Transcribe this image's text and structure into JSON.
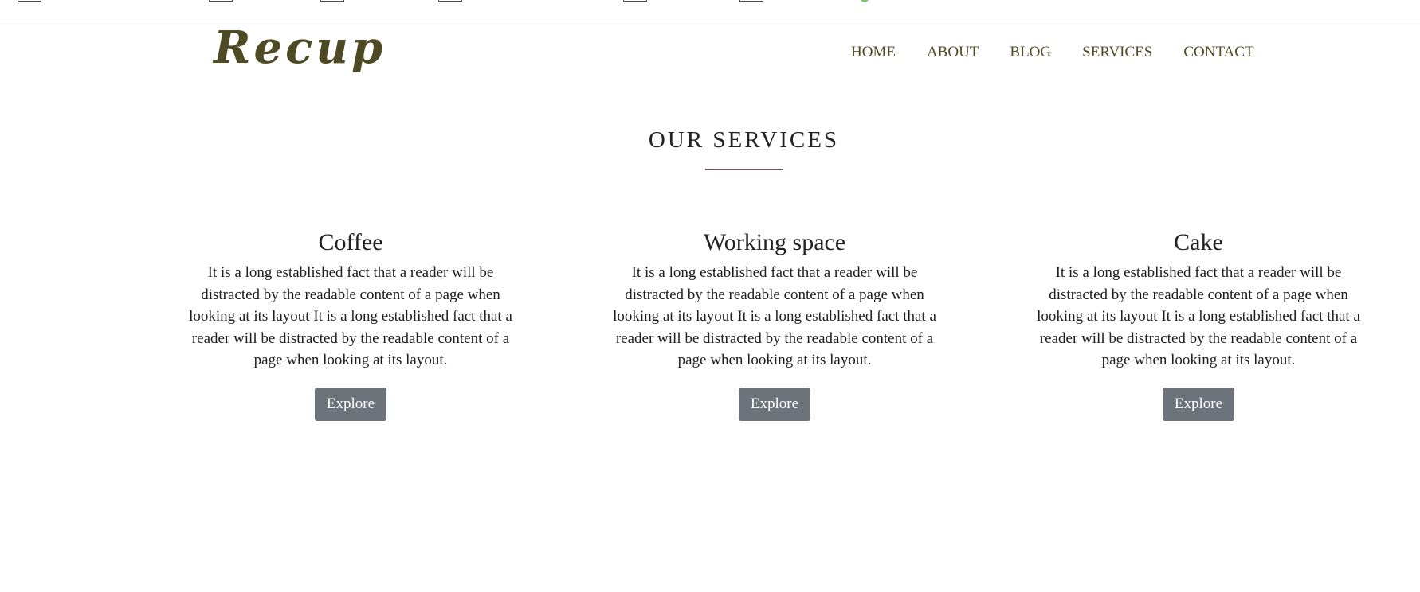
{
  "brand": {
    "logo_text": "Recup"
  },
  "nav": {
    "items": [
      "HOME",
      "ABOUT",
      "BLOG",
      "SERVICES",
      "CONTACT"
    ]
  },
  "services": {
    "title": "OUR SERVICES",
    "cards": [
      {
        "heading": "Coffee",
        "text": "It is a long established fact that a reader will be distracted by the readable content of a page when looking at its layout It is a long established fact that a reader will be distracted by the readable content of a page when looking at its layout.",
        "button": "Explore"
      },
      {
        "heading": "Working space",
        "text": "It is a long established fact that a reader will be distracted by the readable content of a page when looking at its layout It is a long established fact that a reader will be distracted by the readable content of a page when looking at its layout.",
        "button": "Explore"
      },
      {
        "heading": "Cake",
        "text": "It is a long established fact that a reader will be distracted by the readable content of a page when looking at its layout It is a long established fact that a reader will be distracted by the readable content of a page when looking at its layout.",
        "button": "Explore"
      }
    ]
  },
  "colors": {
    "brand": "#4e4a24",
    "button_bg": "#6c737a",
    "button_text": "#ffffff",
    "title_rule": "#6b5a5a"
  }
}
